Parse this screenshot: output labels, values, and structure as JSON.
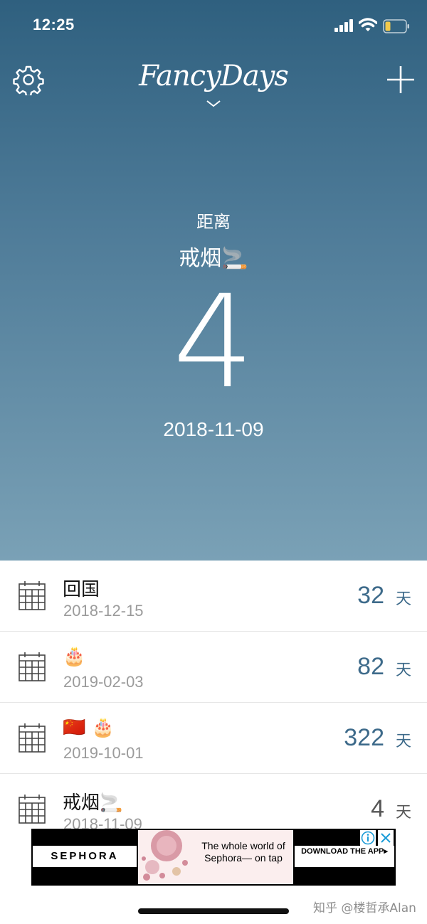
{
  "status": {
    "time": "12:25"
  },
  "header": {
    "logo": "FancyDays"
  },
  "hero": {
    "label": "距离",
    "title": "戒烟🚬",
    "count": "4",
    "date": "2018-11-09"
  },
  "events": [
    {
      "title": "回国",
      "date": "2018-12-15",
      "count": "32",
      "unit": "天"
    },
    {
      "title": "🎂",
      "date": "2019-02-03",
      "count": "82",
      "unit": "天"
    },
    {
      "title": "🇨🇳 🎂",
      "date": "2019-10-01",
      "count": "322",
      "unit": "天"
    },
    {
      "title": "戒烟🚬",
      "date": "2018-11-09",
      "count": "4",
      "unit": "天"
    }
  ],
  "ad": {
    "brand": "SEPHORA",
    "tagline": "The whole world of Sephora— on tap",
    "cta": "DOWNLOAD THE APP▸"
  },
  "watermark": "知乎 @楼哲承Alan",
  "colors": {
    "accent": "#3d6a8a",
    "hero_top": "#2f607f",
    "hero_bottom": "#7aa1b6"
  }
}
